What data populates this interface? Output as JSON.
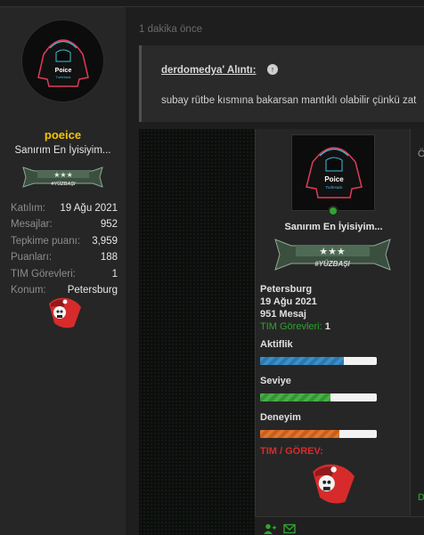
{
  "sidebar": {
    "username": "poeice",
    "user_title": "Sanırım En İyisiyim...",
    "rank_label": "#YÜZBAŞI",
    "stats": [
      {
        "label": "Katılım:",
        "value": "19 Ağu 2021"
      },
      {
        "label": "Mesajlar:",
        "value": "952"
      },
      {
        "label": "Tepkime puanı:",
        "value": "3,959"
      },
      {
        "label": "Puanları:",
        "value": "188"
      },
      {
        "label": "TIM Görevleri:",
        "value": "1"
      },
      {
        "label": "Konum:",
        "value": "Petersburg"
      }
    ]
  },
  "post": {
    "time": "1 dakika önce",
    "quote_author": "derdomedya' Alıntı:",
    "quote_text": "subay rütbe kısmına bakarsan mantıklı olabilir çünkü zat"
  },
  "embed": {
    "right_text": "Ö",
    "right_bottom": "D",
    "user_title": "Sanırım En İyisiyim...",
    "rank_label": "#YÜZBAŞI",
    "location": "Petersburg",
    "joined": "19 Ağu 2021",
    "messages": "951 Mesaj",
    "tim_label": "TIM Görevleri:",
    "tim_value": "1",
    "bars": [
      {
        "name": "Aktiflik",
        "fill": 0.72,
        "color": "blue"
      },
      {
        "name": "Seviye",
        "fill": 0.6,
        "color": "green"
      },
      {
        "name": "Deneyim",
        "fill": 0.68,
        "color": "orange"
      }
    ],
    "gorev_title": "TIM / GÖREV:"
  },
  "colors": {
    "username": "#f5c400",
    "online": "#2fa52f",
    "gorev": "#d72b2b",
    "tim": "#2ea32e"
  }
}
